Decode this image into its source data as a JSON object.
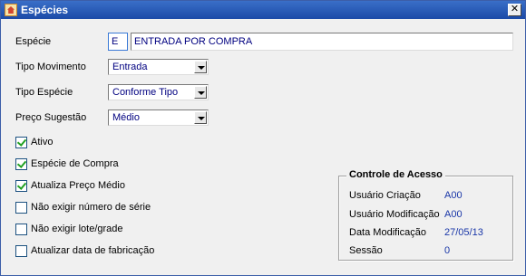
{
  "window": {
    "title": "Espécies",
    "close_glyph": "✕"
  },
  "form": {
    "especie": {
      "label": "Espécie",
      "code": "E",
      "description": "ENTRADA POR COMPRA"
    },
    "tipo_movimento": {
      "label": "Tipo Movimento",
      "value": "Entrada"
    },
    "tipo_especie": {
      "label": "Tipo Espécie",
      "value": "Conforme Tipo"
    },
    "preco_sugestao": {
      "label": "Preço Sugestão",
      "value": "Médio"
    }
  },
  "checkboxes": [
    {
      "label": "Ativo",
      "checked": true
    },
    {
      "label": "Espécie de Compra",
      "checked": true
    },
    {
      "label": "Atualiza Preço Médio",
      "checked": true
    },
    {
      "label": "Não exigir número de série",
      "checked": false
    },
    {
      "label": "Não exigir lote/grade",
      "checked": false
    },
    {
      "label": "Atualizar data de fabricação",
      "checked": false
    }
  ],
  "access_control": {
    "title": "Controle de Acesso",
    "rows": [
      {
        "label": "Usuário Criação",
        "value": "A00"
      },
      {
        "label": "Usuário Modificação",
        "value": "A00"
      },
      {
        "label": "Data Modificação",
        "value": "27/05/13"
      },
      {
        "label": "Sessão",
        "value": "0"
      }
    ]
  },
  "colors": {
    "titlebar": "#1b4aa7",
    "value_text": "#000080",
    "check": "#21a121"
  }
}
